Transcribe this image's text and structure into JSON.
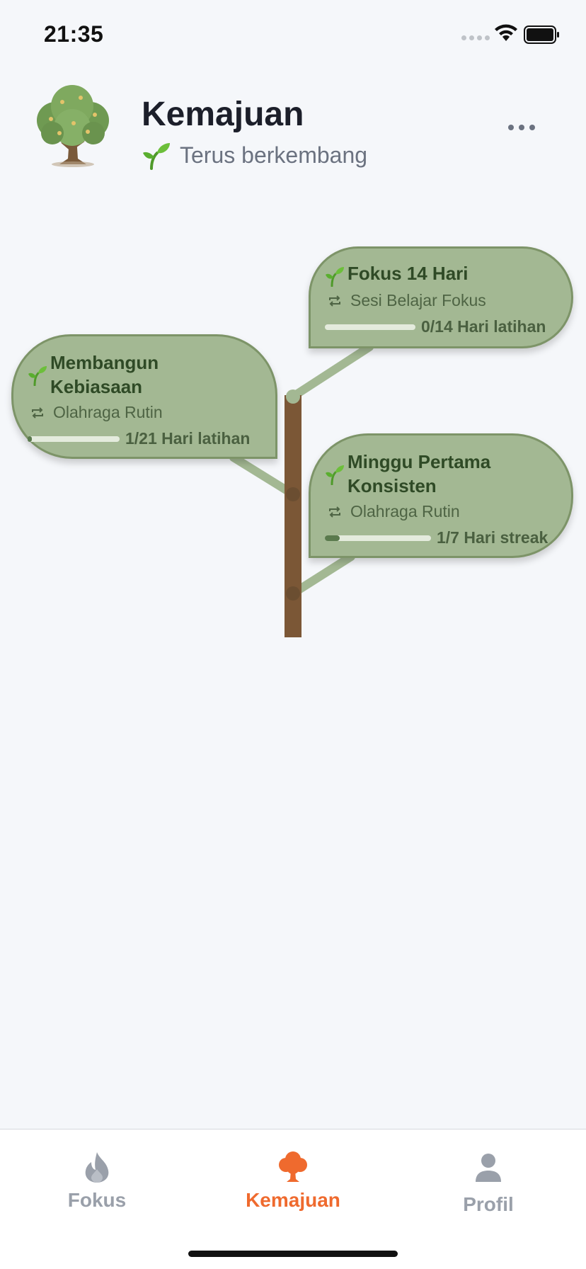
{
  "status_bar": {
    "time": "21:35"
  },
  "header": {
    "title": "Kemajuan",
    "subtitle": "Terus berkembang",
    "logo_icon": "tree-icon",
    "menu_icon": "more-horizontal-icon"
  },
  "milestones": [
    {
      "title_1": "Fokus 14 Hari",
      "title_2": "",
      "habit": "Sesi Belajar Fokus",
      "progress_label": "0/14 Hari latihan",
      "progress": 0.0
    },
    {
      "title_1": "Membangun",
      "title_2": "Kebiasaan",
      "habit": "Olahraga Rutin",
      "progress_label": "1/21 Hari latihan",
      "progress": 0.048
    },
    {
      "title_1": "Minggu Pertama",
      "title_2": "Konsisten",
      "habit": "Olahraga Rutin",
      "progress_label": "1/7 Hari streak",
      "progress": 0.143
    }
  ],
  "bottom_nav": {
    "tabs": [
      {
        "label": "Fokus",
        "icon": "flame-icon",
        "active": false
      },
      {
        "label": "Kemajuan",
        "icon": "tree-icon",
        "active": true
      },
      {
        "label": "Profil",
        "icon": "person-icon",
        "active": false
      }
    ]
  },
  "colors": {
    "accent": "#ef6a2e",
    "leaf": "#a3b893",
    "trunk": "#7b5736",
    "inactive": "#9aa0aa"
  }
}
